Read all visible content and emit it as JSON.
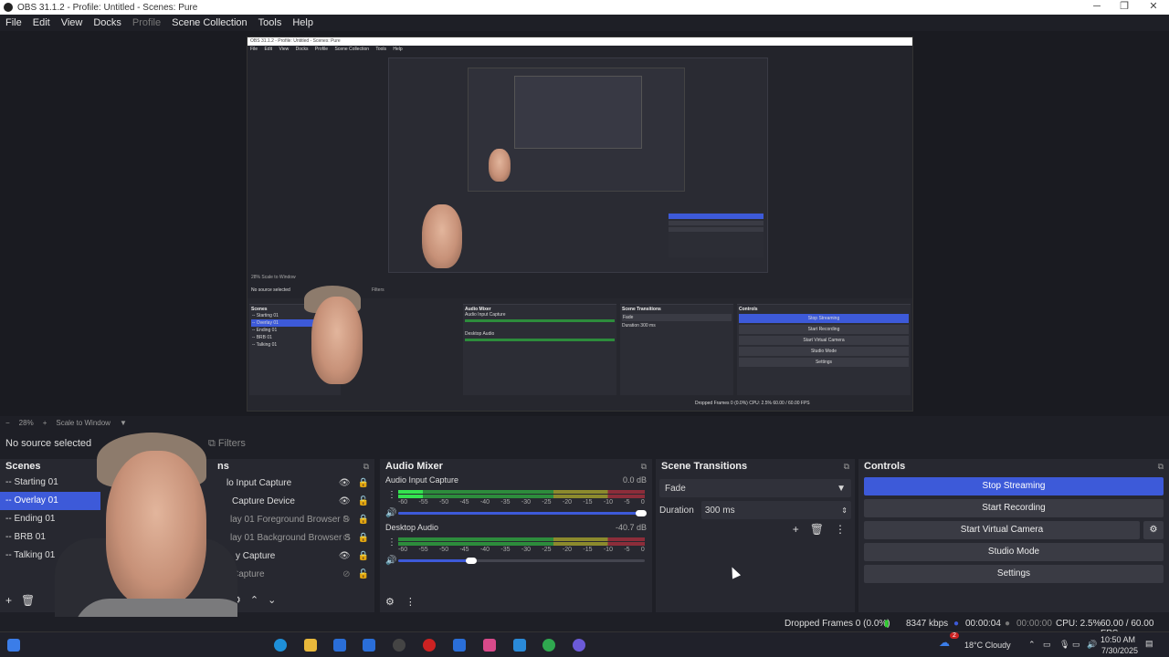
{
  "window": {
    "title": "OBS 31.1.2 - Profile: Untitled - Scenes: Pure"
  },
  "menu": [
    "File",
    "Edit",
    "View",
    "Docks",
    "Profile",
    "Scene Collection",
    "Tools",
    "Help"
  ],
  "zoom": {
    "level": "28%",
    "plus": "+",
    "minus": "−",
    "mode": "Scale to Window"
  },
  "source_toolbar": {
    "no_source": "No source selected",
    "filters": "Filters"
  },
  "scenes": {
    "title": "Scenes",
    "items": [
      "-- Starting 01",
      "-- Overlay 01",
      "-- Ending 01",
      "-- BRB 01",
      "-- Talking 01"
    ],
    "selected_index": 1
  },
  "sources": {
    "title_fragment": "ns",
    "items": [
      "Audio Input Capture",
      "Video Capture Device",
      "Overlay 01  Foreground Browser S",
      "Overlay 01  Background Browser S",
      "Display Capture",
      "Window Capture"
    ],
    "visible_fragments": [
      "lo Input Capture",
      "Capture Device",
      "lay 01  Foreground Browser S",
      "lay 01  Background Browser S",
      "y Capture",
      "Capture"
    ]
  },
  "audio_mixer": {
    "title": "Audio Mixer",
    "channels": [
      {
        "name": "Audio Input Capture",
        "db": "0.0 dB",
        "volume": 0.97,
        "level": 0.1
      },
      {
        "name": "Desktop Audio",
        "db": "-40.7 dB",
        "volume": 0.3,
        "level": 0.0
      }
    ],
    "ticks": [
      "-60",
      "-55",
      "-50",
      "-45",
      "-40",
      "-35",
      "-30",
      "-25",
      "-20",
      "-15",
      "-10",
      "-5",
      "0"
    ]
  },
  "scene_transitions": {
    "title": "Scene Transitions",
    "transition": "Fade",
    "duration_label": "Duration",
    "duration_value": "300 ms"
  },
  "controls": {
    "title": "Controls",
    "buttons": [
      "Stop Streaming",
      "Start Recording",
      "Start Virtual Camera",
      "Studio Mode",
      "Settings"
    ]
  },
  "status": {
    "dropped_frames": "Dropped Frames 0 (0.0%)",
    "bitrate": "8347 kbps",
    "stream_time": "00:00:04",
    "rec_time": "00:00:00",
    "cpu": "CPU: 2.5%",
    "fps": "60.00 / 60.00 FPS"
  },
  "taskbar": {
    "weather": "18°C  Cloudy",
    "time": "10:50 AM",
    "date": "7/30/2025",
    "notification_count": "2"
  },
  "preview_nested": {
    "title": "OBS 31.1.2 - Profile: Untitled - Scenes: Pure",
    "menu": [
      "File",
      "Edit",
      "View",
      "Docks",
      "Profile",
      "Scene Collection",
      "Tools",
      "Help"
    ],
    "zoom": "28%",
    "scale_mode": "Scale to Window",
    "no_source": "No source selected",
    "filters": "Filters",
    "scenes_title": "Scenes",
    "scenes": [
      "-- Starting 01",
      "-- Overlay 01",
      "-- Ending 01",
      "-- BRB 01",
      "-- Talking 01"
    ],
    "mixer_title": "Audio Mixer",
    "mixer_ch1": "Audio Input Capture",
    "mixer_ch2": "Desktop Audio",
    "transitions_title": "Scene Transitions",
    "transition": "Fade",
    "duration": "Duration",
    "duration_value": "300 ms",
    "controls_title": "Controls",
    "buttons": [
      "Stop Streaming",
      "Start Recording",
      "Start Virtual Camera",
      "Studio Mode",
      "Settings"
    ],
    "status": "Dropped Frames 0 (0.0%)",
    "cpu": "CPU: 2.5%",
    "fps": "60.00 / 60.00 FPS"
  },
  "colors": {
    "accent": "#3d5ad9",
    "panel": "#272830",
    "background": "#1e1f26"
  }
}
